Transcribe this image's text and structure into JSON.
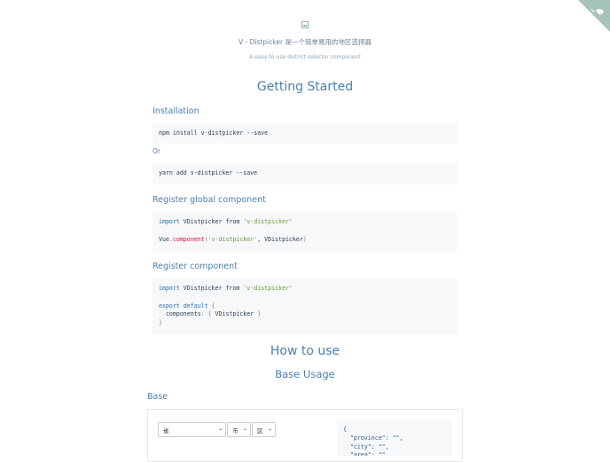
{
  "header": {
    "title": "V - Distpicker 是一个简单易用的地区选择器",
    "description": "A easy-to-use district selector component"
  },
  "sections": {
    "getting_started": "Getting Started",
    "installation": "Installation",
    "or": "Or",
    "register_global": "Register global component",
    "register_component": "Register component",
    "how_to_use": "How to use",
    "base_usage": "Base Usage",
    "base": "Base"
  },
  "code": {
    "npm": "npm install v-distpicker --save",
    "yarn": "yarn add v-distpicker --save",
    "global_import_kw": "import",
    "global_import_name": " VDistpicker ",
    "global_from_kw": "from",
    "global_import_str": "'v-distpicker'",
    "global_vue": "Vue",
    "global_dot": ".",
    "global_component": "component",
    "global_open": "(",
    "global_str": "'v-distpicker'",
    "global_rest": ", VDistpicker",
    "global_close": ")",
    "local_import_kw": "import",
    "local_import_name": " VDistpicker ",
    "local_from_kw": "from",
    "local_import_str": "'v-distpicker'",
    "local_export": "export",
    "local_default": "default",
    "local_open_brace": "{",
    "local_components": "  components",
    "local_colon": ": ",
    "local_obj_open": "{",
    "local_obj_name": " VDistpicker ",
    "local_obj_close": "}",
    "local_close_brace": "}"
  },
  "demo": {
    "province": "省",
    "city": "市",
    "area": "区",
    "json": "{\n  \"province\": \"\",\n  \"city\": \"\",\n  \"area\": \"\""
  },
  "colors": {
    "accent": "#4a80b5",
    "corner": "#a7c4ba"
  }
}
